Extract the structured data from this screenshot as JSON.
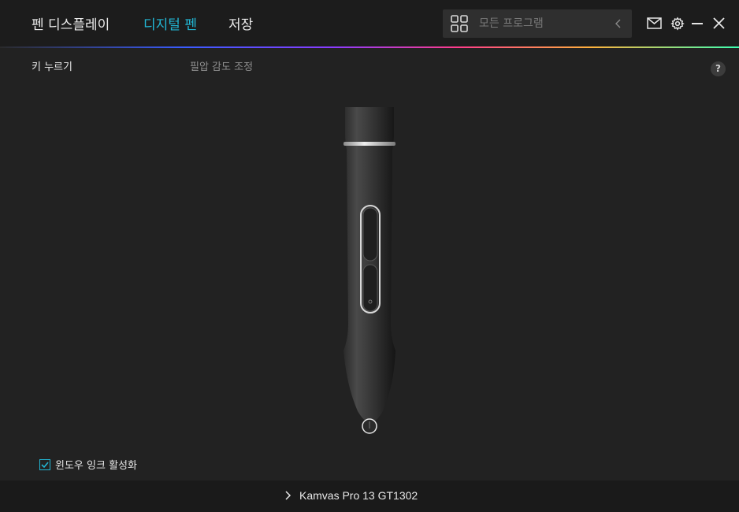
{
  "nav": {
    "tabs": [
      {
        "label": "펜 디스플레이",
        "active": false
      },
      {
        "label": "디지털 펜",
        "active": true
      },
      {
        "label": "저장",
        "active": false
      }
    ]
  },
  "search": {
    "placeholder": "모든 프로그램"
  },
  "subtabs": [
    {
      "label": "키 누르기",
      "active": true
    },
    {
      "label": "필압 감도 조정",
      "active": false
    }
  ],
  "help": {
    "label": "?"
  },
  "windows_ink": {
    "label": "윈도우 잉크 활성화",
    "checked": true
  },
  "footer": {
    "device_name": "Kamvas Pro 13 GT1302"
  },
  "colors": {
    "accent": "#22b6d4",
    "background": "#222222",
    "topbar": "#1c1c1c"
  },
  "icons": [
    "grid-icon",
    "chevron-left-icon",
    "mail-icon",
    "gear-icon",
    "minimize-icon",
    "close-icon",
    "help-icon",
    "checkbox-check-icon",
    "chevron-right-icon"
  ]
}
